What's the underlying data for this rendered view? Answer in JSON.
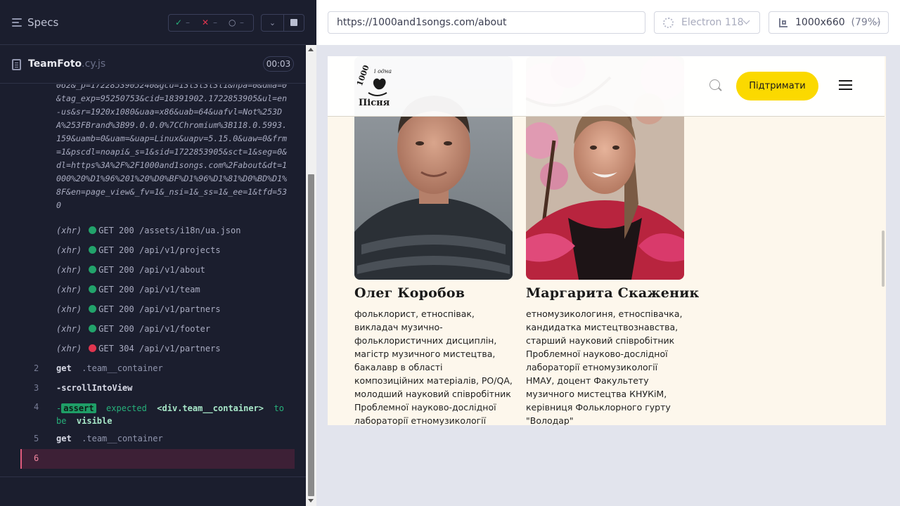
{
  "runner": {
    "specs_label": "Specs",
    "stats": {
      "passed_icon": "✓",
      "passed": "–",
      "failed_icon": "✕",
      "failed": "–",
      "pending_icon": "○",
      "pending": "–"
    },
    "spec_file": {
      "name": "TeamFoto",
      "ext": ".cy.js",
      "time": "00:03"
    },
    "log_url_fragment": "062&_p=1722853905240&gcd=13l3l3l3l1&npa=0&dma=0&tag_exp=95250753&cid=18391902.1722853905&ul=en-us&sr=1920x1080&uaa=x86&uab=64&uafvl=Not%253DA%253FBrand%3B99.0.0.0%7CChromium%3B118.0.5993.159&uamb=0&uam=&uap=Linux&uapv=5.15.0&uaw=0&frm=1&pscdl=noapi&_s=1&sid=1722853905&sct=1&seg=0&dl=https%3A%2F%2F1000and1songs.com%2Fabout&dt=1000%20%D1%96%201%20%D0%BF%D1%96%D1%81%D0%BD%D1%8F&en=page_view&_fv=1&_nsi=1&_ss=1&_ee=1&tfd=530",
    "xhr": [
      {
        "label": "(xhr)",
        "method": "GET",
        "status": "200",
        "path": "/assets/i18n/ua.json",
        "color": "#22a36b"
      },
      {
        "label": "(xhr)",
        "method": "GET",
        "status": "200",
        "path": "/api/v1/projects",
        "color": "#22a36b"
      },
      {
        "label": "(xhr)",
        "method": "GET",
        "status": "200",
        "path": "/api/v1/about",
        "color": "#22a36b"
      },
      {
        "label": "(xhr)",
        "method": "GET",
        "status": "200",
        "path": "/api/v1/team",
        "color": "#22a36b"
      },
      {
        "label": "(xhr)",
        "method": "GET",
        "status": "200",
        "path": "/api/v1/partners",
        "color": "#22a36b"
      },
      {
        "label": "(xhr)",
        "method": "GET",
        "status": "200",
        "path": "/api/v1/footer",
        "color": "#22a36b"
      },
      {
        "label": "(xhr)",
        "method": "GET",
        "status": "304",
        "path": "/api/v1/partners",
        "color": "#e0354f"
      }
    ],
    "commands": {
      "c2": {
        "num": "2",
        "kw": "get",
        "sel": ".team__container"
      },
      "c3": {
        "num": "3",
        "kw": "-scrollIntoView"
      },
      "c4": {
        "num": "4",
        "prefix": "-",
        "badge": "assert",
        "t1": "expected",
        "t2": "<div.team__container>",
        "t3": "to",
        "t4": "be",
        "t5": "visible"
      },
      "c5": {
        "num": "5",
        "kw": "get",
        "sel": ".team__container"
      },
      "c6": {
        "num": "6"
      }
    }
  },
  "browser": {
    "url": "https://1000and1songs.com/about",
    "browser_name": "Electron 118",
    "viewport": "1000x660",
    "zoom": "(79%)"
  },
  "site": {
    "support_label": "Підтримати",
    "logo_text": {
      "top": "1000",
      "mid": "і одна",
      "bottom": "Пісня"
    },
    "team": [
      {
        "name": "Олег Коробов",
        "desc": "фольклорист, етноспівак, викладач музично-фольклористичних дисциплін, магістр музичного мистецтва, бакалавр в області композиційних матеріалів, PO/QA, молодший науковий співробітник Проблемної науково-дослідної лабораторії етномузикології НМАУ, учасник Фольклорного гурту"
      },
      {
        "name": "Маргарита Скаженик",
        "desc": "етномузикологиня, етноспівачка, кандидатка мистецтвознавства, старший науковий співробітник Проблемної науково-дослідної лабораторії етномузикології НМАУ, доцент Факультету музичного мистецтва КНУКіМ, керівниця Фольклорного гурту \"Володар\""
      }
    ]
  }
}
